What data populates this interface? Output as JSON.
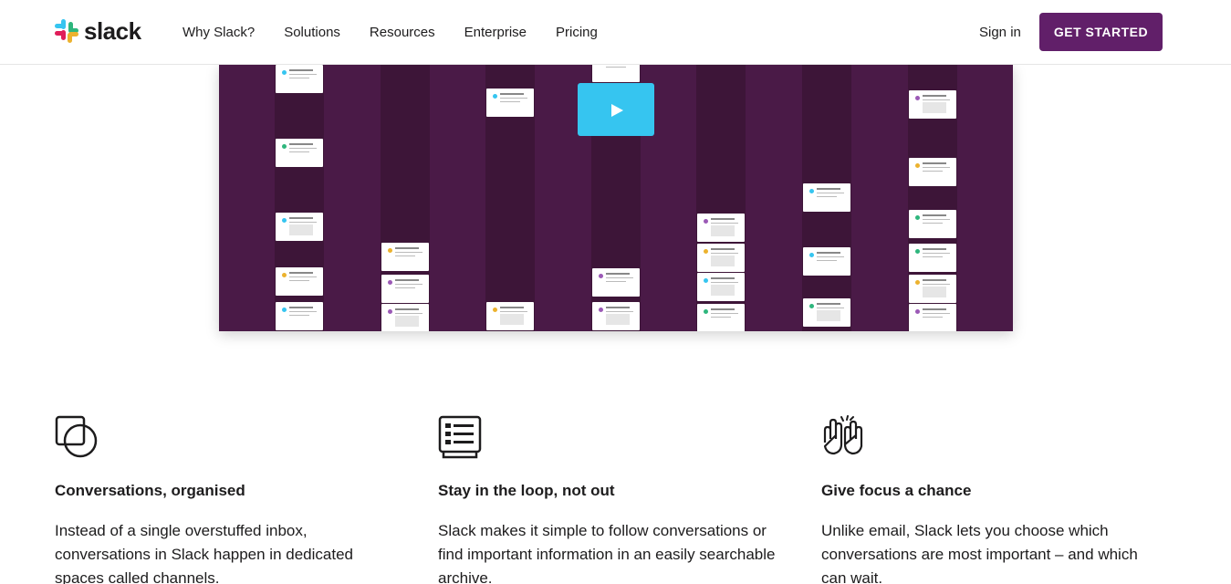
{
  "nav": {
    "logo_text": "slack",
    "links": [
      "Why Slack?",
      "Solutions",
      "Resources",
      "Enterprise",
      "Pricing"
    ],
    "signin": "Sign in",
    "cta": "GET STARTED"
  },
  "colors": {
    "brand_purple": "#611f69",
    "video_bg": "#4a1a47",
    "play_blue": "#36c5f0",
    "dot_blue": "#36c5f0",
    "dot_yellow": "#ecb22e",
    "dot_green": "#2eb67d",
    "dot_purple": "#9b59b6"
  },
  "video": {
    "play_icon": "play-icon"
  },
  "features": [
    {
      "icon": "overlapping-squares-icon",
      "title": "Conversations, organised",
      "body": "Instead of a single overstuffed inbox, conversations in Slack happen in dedicated spaces called channels."
    },
    {
      "icon": "list-document-icon",
      "title": "Stay in the loop, not out",
      "body": "Slack makes it simple to follow conversations or find important information in an easily searchable archive."
    },
    {
      "icon": "high-five-icon",
      "title": "Give focus a chance",
      "body": "Unlike email, Slack lets you choose which conversations are most important – and which can wait."
    }
  ]
}
